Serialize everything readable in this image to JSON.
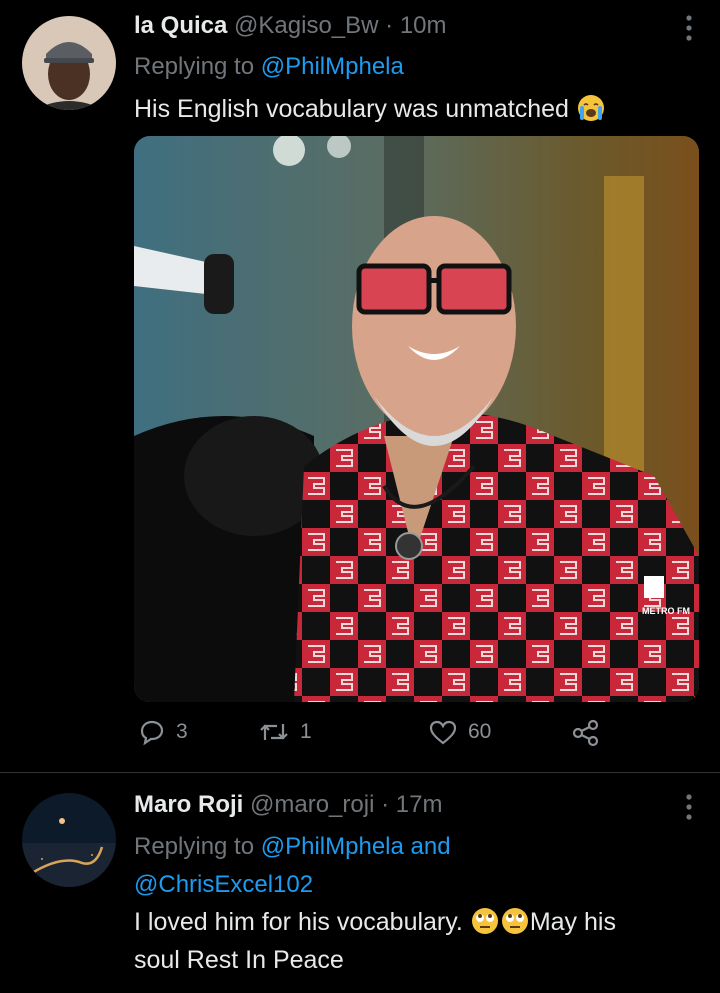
{
  "tweets": [
    {
      "display_name": "la Quica",
      "handle": "@Kagiso_Bw",
      "time": "· 10m",
      "replying_prefix": "Replying to",
      "replying_to": "@PhilMphela",
      "text": "His English vocabulary was unmatched",
      "emoji": "loudly-crying-face",
      "media_watermark": "METRO FM",
      "actions": {
        "reply_count": "3",
        "retweet_count": "1",
        "like_count": "60"
      }
    },
    {
      "display_name": "Maro Roji",
      "handle": "@maro_roji",
      "time": "· 17m",
      "replying_prefix": "Replying to",
      "replying_to": "@PhilMphela and",
      "replying_to_2": "@ChrisExcel102",
      "text_part1": "I loved him for his vocabulary.",
      "text_part2": "May his",
      "text_line2": "soul Rest In Peace",
      "emoji": "face-with-rolling-eyes"
    }
  ],
  "colors": {
    "background": "#000000",
    "text": "#e7e9ea",
    "muted": "#71767b",
    "link": "#1d9bf0",
    "divider": "#2f3336"
  },
  "icons": [
    "more-icon",
    "reply-icon",
    "retweet-icon",
    "like-icon",
    "share-icon"
  ]
}
